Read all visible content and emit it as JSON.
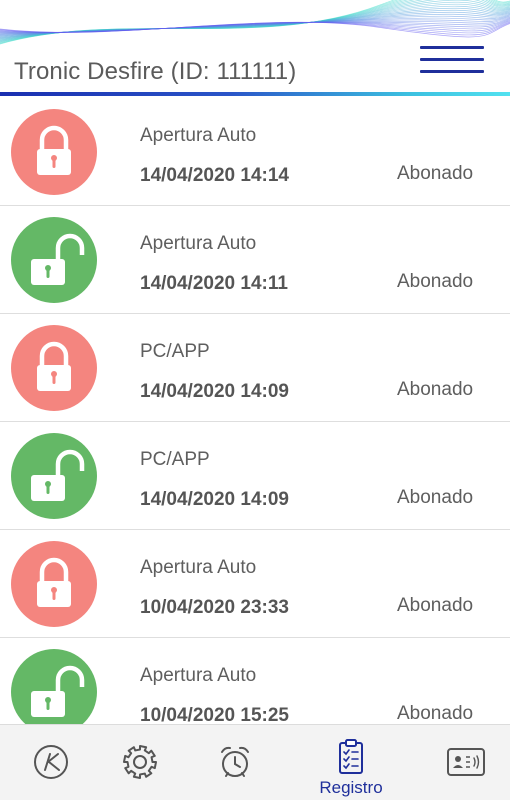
{
  "header": {
    "title": "Tronic Desfire (ID: 111111)"
  },
  "colors": {
    "brand": "#1f2f9b",
    "closed": "#f4857f",
    "open": "#64b866"
  },
  "log": [
    {
      "state": "closed",
      "icon": "lock-closed-icon",
      "source": "Apertura Auto",
      "datetime": "14/04/2020 14:14",
      "status": "Abonado"
    },
    {
      "state": "open",
      "icon": "lock-open-icon",
      "source": "Apertura Auto",
      "datetime": "14/04/2020 14:11",
      "status": "Abonado"
    },
    {
      "state": "closed",
      "icon": "lock-closed-icon",
      "source": "PC/APP",
      "datetime": "14/04/2020 14:09",
      "status": "Abonado"
    },
    {
      "state": "open",
      "icon": "lock-open-icon",
      "source": "PC/APP",
      "datetime": "14/04/2020 14:09",
      "status": "Abonado"
    },
    {
      "state": "closed",
      "icon": "lock-closed-icon",
      "source": "Apertura Auto",
      "datetime": "10/04/2020 23:33",
      "status": "Abonado"
    },
    {
      "state": "open",
      "icon": "lock-open-icon",
      "source": "Apertura Auto",
      "datetime": "10/04/2020 15:25",
      "status": "Abonado"
    }
  ],
  "nav": {
    "items": [
      {
        "icon": "k-logo-icon",
        "label": ""
      },
      {
        "icon": "gear-icon",
        "label": ""
      },
      {
        "icon": "alarm-clock-icon",
        "label": ""
      },
      {
        "icon": "clipboard-checklist-icon",
        "label": "Registro",
        "active": true
      },
      {
        "icon": "id-card-icon",
        "label": ""
      }
    ]
  }
}
